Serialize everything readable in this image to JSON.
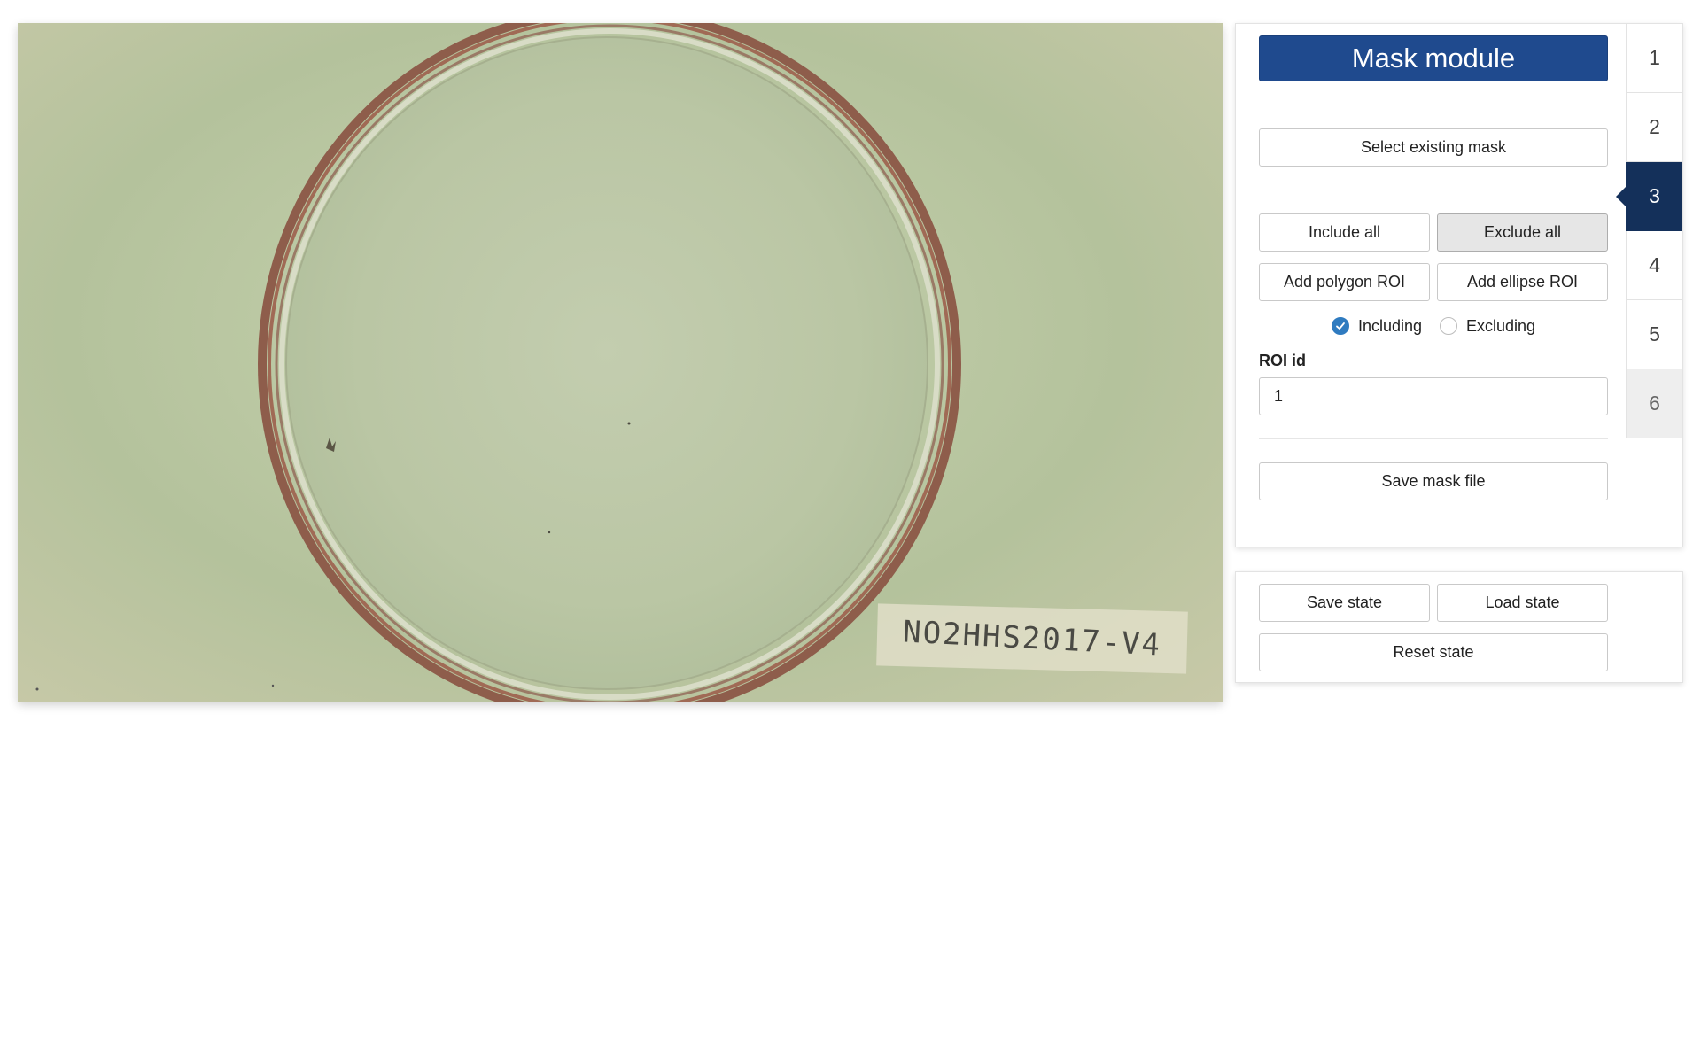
{
  "viewer": {
    "plate_label": "NO2HHS2017-V4",
    "background_color": "#bcc9a4",
    "rim_color": "#8a5a48"
  },
  "panel": {
    "title": "Mask module",
    "select_mask_label": "Select existing mask",
    "include_all_label": "Include all",
    "exclude_all_label": "Exclude all",
    "add_polygon_label": "Add polygon ROI",
    "add_ellipse_label": "Add ellipse ROI",
    "mode": {
      "including_label": "Including",
      "excluding_label": "Excluding",
      "selected": "Including"
    },
    "roi_id_label": "ROI id",
    "roi_id_value": "1",
    "save_mask_label": "Save mask file",
    "accent_color": "#1f4a8e"
  },
  "steps": {
    "items": [
      "1",
      "2",
      "3",
      "4",
      "5",
      "6"
    ],
    "active": "3"
  },
  "state": {
    "save_label": "Save state",
    "load_label": "Load state",
    "reset_label": "Reset state"
  }
}
